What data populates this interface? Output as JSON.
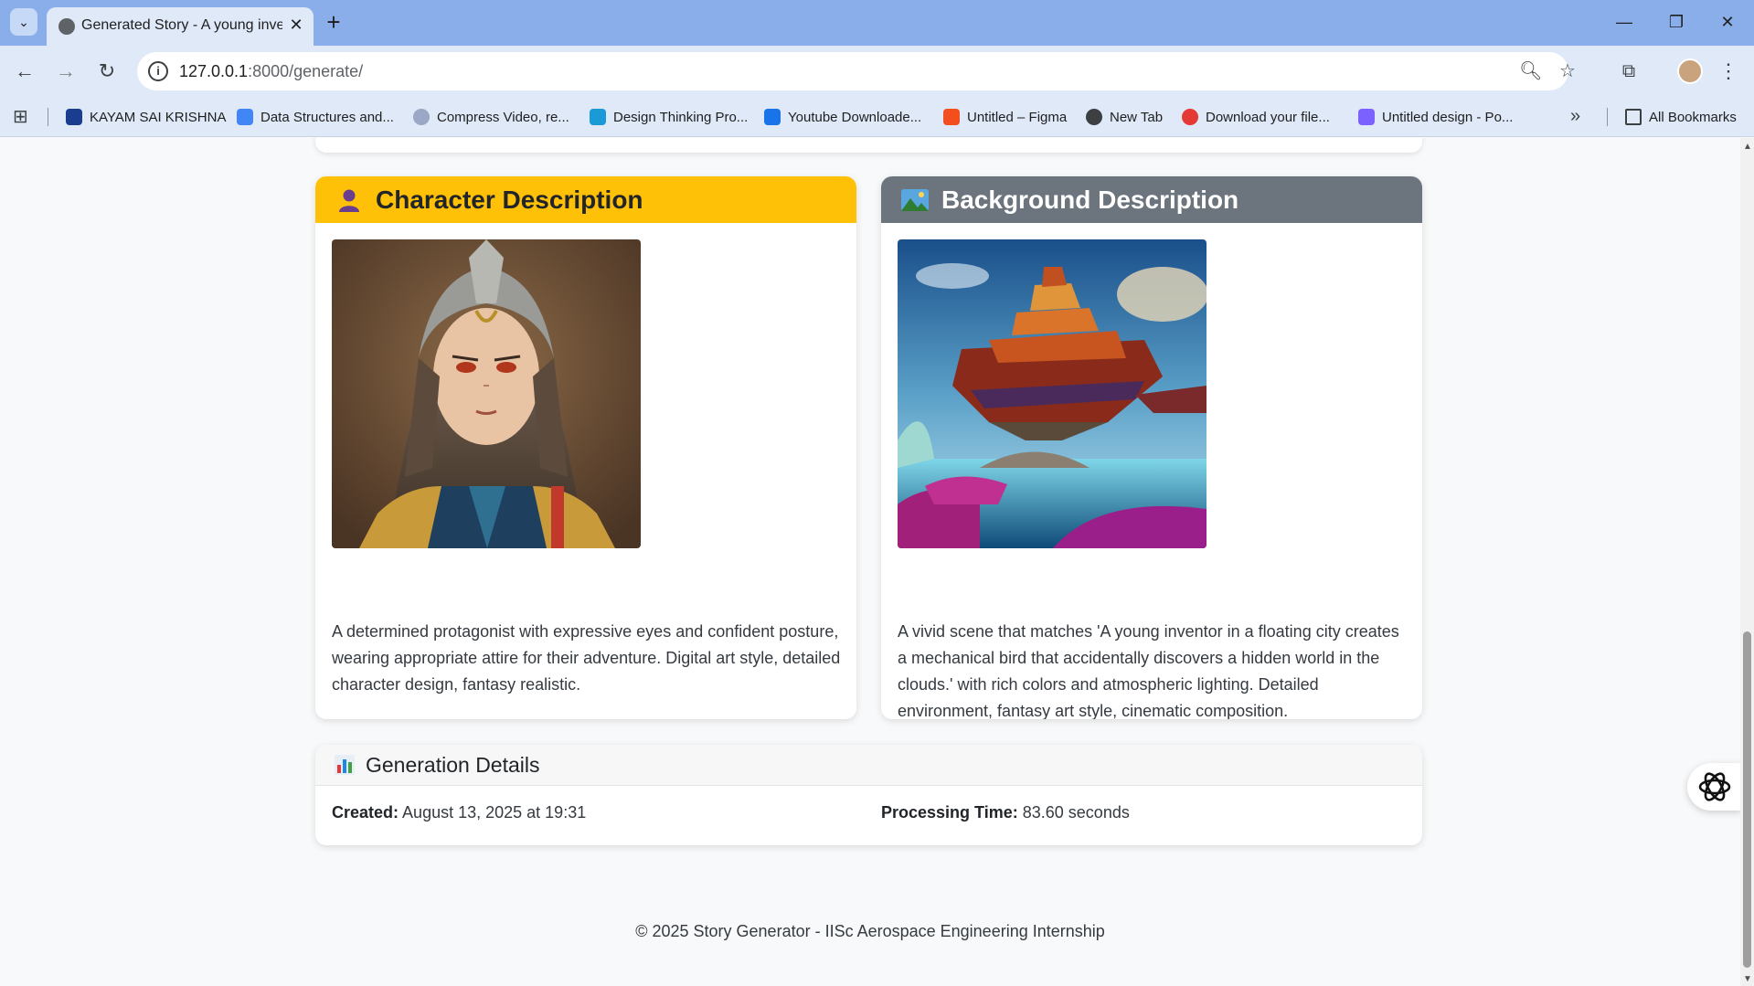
{
  "browser": {
    "tab_title": "Generated Story - A young inventor in a floating city",
    "url_host": "127.0.0.1",
    "url_path": ":8000/generate/",
    "bookmarks": [
      {
        "label": "KAYAM SAI KRISHNA",
        "color": "#1a3d8f"
      },
      {
        "label": "Data Structures and...",
        "color": "#4285f4"
      },
      {
        "label": "Compress Video, re...",
        "color": "#9aa7c7"
      },
      {
        "label": "Design Thinking Pro...",
        "color": "#1a9ad6"
      },
      {
        "label": "Youtube Downloade...",
        "color": "#1a73e8"
      },
      {
        "label": "Untitled – Figma",
        "color": "#f24e1e"
      },
      {
        "label": "New Tab",
        "color": "#3c4043"
      },
      {
        "label": "Download your file...",
        "color": "#e53935"
      },
      {
        "label": "Untitled design - Po...",
        "color": "#7b61ff"
      }
    ],
    "all_bookmarks_label": "All Bookmarks"
  },
  "character": {
    "title": "Character Description",
    "icon": "person-silhouette-icon",
    "accent": "#ffc107",
    "description": "A determined protagonist with expressive eyes and confident posture, wearing appropriate attire for their adventure. Digital art style, detailed character design, fantasy realistic."
  },
  "background": {
    "title": "Background Description",
    "icon": "landscape-icon",
    "accent": "#6c757d",
    "description": "A vivid scene that matches 'A young inventor in a floating city creates a mechanical bird that accidentally discovers a hidden world in the clouds.' with rich colors and atmospheric lighting. Detailed environment, fantasy art style, cinematic composition."
  },
  "details": {
    "title": "Generation Details",
    "icon": "bar-chart-icon",
    "created_label": "Created:",
    "created_value": "August 13, 2025 at 19:31",
    "processing_label": "Processing Time:",
    "processing_value": "83.60 seconds"
  },
  "footer": {
    "text": "© 2025 Story Generator - IISc Aerospace Engineering Internship"
  }
}
